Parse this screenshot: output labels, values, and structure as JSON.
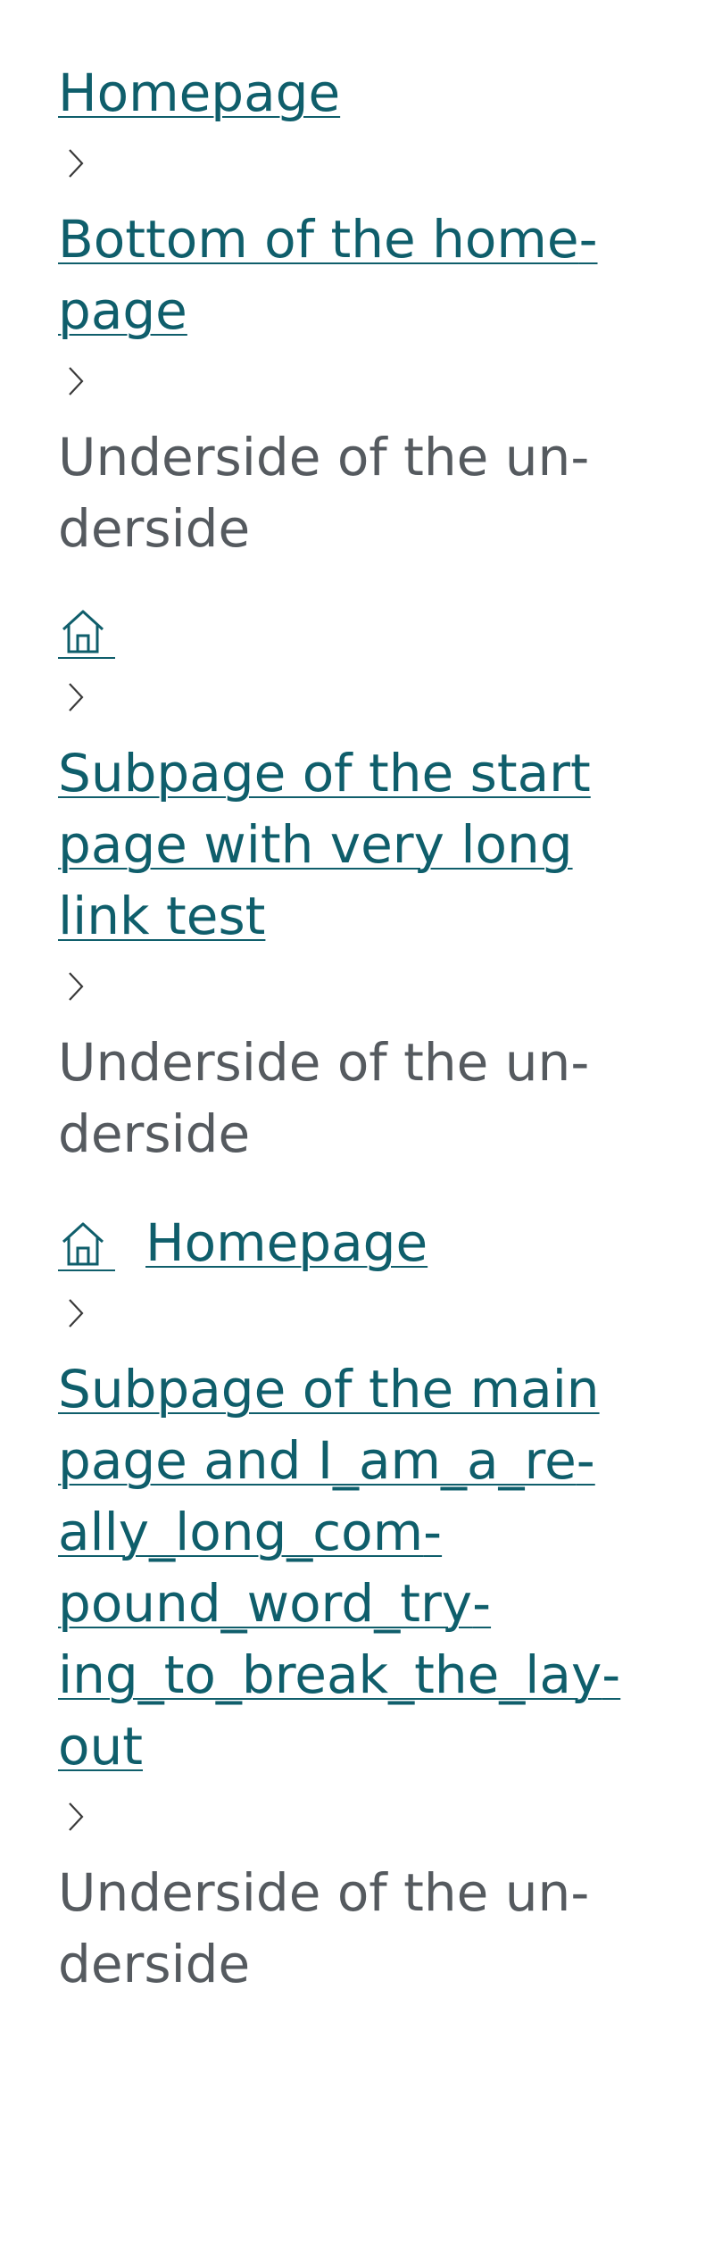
{
  "breadcrumbs": [
    {
      "items": [
        {
          "type": "link",
          "label": "Homepage"
        },
        {
          "type": "link",
          "label": "Bottom of the home­page"
        },
        {
          "type": "current",
          "label": "Underside of the un­derside"
        }
      ]
    },
    {
      "items": [
        {
          "type": "home-icon",
          "label": ""
        },
        {
          "type": "link",
          "label": "Subpage of the start page with very long link test"
        },
        {
          "type": "current",
          "label": "Underside of the un­derside"
        }
      ]
    },
    {
      "items": [
        {
          "type": "home-icon-label",
          "label": "Homepage"
        },
        {
          "type": "link",
          "label": "Subpage of the main page and I_am_a_re­ally_long_com­pound_word_try­ing_to_break_the_lay­out"
        },
        {
          "type": "current",
          "label": "Underside of the un­derside"
        }
      ]
    }
  ],
  "icons": {
    "home": "home-icon",
    "separator": "chevron-right-icon"
  },
  "colors": {
    "link": "#0f5e6b",
    "current": "#555a5f",
    "separator": "#3a3a3a"
  }
}
